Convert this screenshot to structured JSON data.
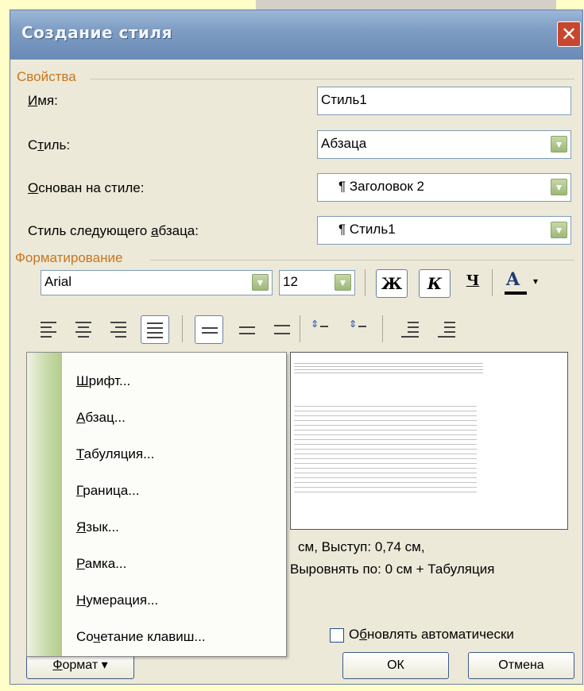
{
  "window": {
    "title": "Создание стиля",
    "close_glyph": "✕"
  },
  "properties": {
    "group_label": "Свойства",
    "name": {
      "label_u": "И",
      "label_rest": "мя:",
      "value": "Стиль1"
    },
    "style": {
      "label_pre": "С",
      "label_u": "т",
      "label_rest": "иль:",
      "value": "Абзаца"
    },
    "based_on": {
      "label_u": "О",
      "label_rest": "снован на стиле:",
      "value": "¶ Заголовок 2"
    },
    "next": {
      "label_pre": "Стиль следующего ",
      "label_u": "а",
      "label_rest": "бзаца:",
      "value": "¶ Стиль1"
    }
  },
  "formatting": {
    "group_label": "Форматирование",
    "font_name": "Arial",
    "font_size": "12",
    "bold": "Ж",
    "italic": "К",
    "underline": "Ч",
    "font_color": "A",
    "font_color_hex": "#000000"
  },
  "description": {
    "line1": "см, Выступ:  0,74 см,",
    "line2": "Выровнять по:  0 см + Табуляция"
  },
  "format_menu": {
    "items": [
      {
        "u": "Ш",
        "rest": "рифт..."
      },
      {
        "u": "А",
        "rest": "бзац..."
      },
      {
        "u": "Т",
        "rest": "абуляция..."
      },
      {
        "u": "Г",
        "rest": "раница..."
      },
      {
        "u": "Я",
        "rest": "зык..."
      },
      {
        "u": "Р",
        "rest": "амка..."
      },
      {
        "u": "Н",
        "rest": "умерация..."
      },
      {
        "pre": "Со",
        "u": "ч",
        "rest": "етание клавиш..."
      }
    ]
  },
  "auto_update": {
    "pre": "О",
    "u": "б",
    "rest": "новлять автоматически",
    "checked": false
  },
  "buttons": {
    "format": {
      "u": "Ф",
      "rest": "ормат",
      "arrow": "▾"
    },
    "ok": "ОК",
    "cancel": "Отмена"
  },
  "colors": {
    "accent_orange": "#c8761e",
    "title_bar": "#7e9dc3",
    "dropdown_green": "#9db878"
  }
}
